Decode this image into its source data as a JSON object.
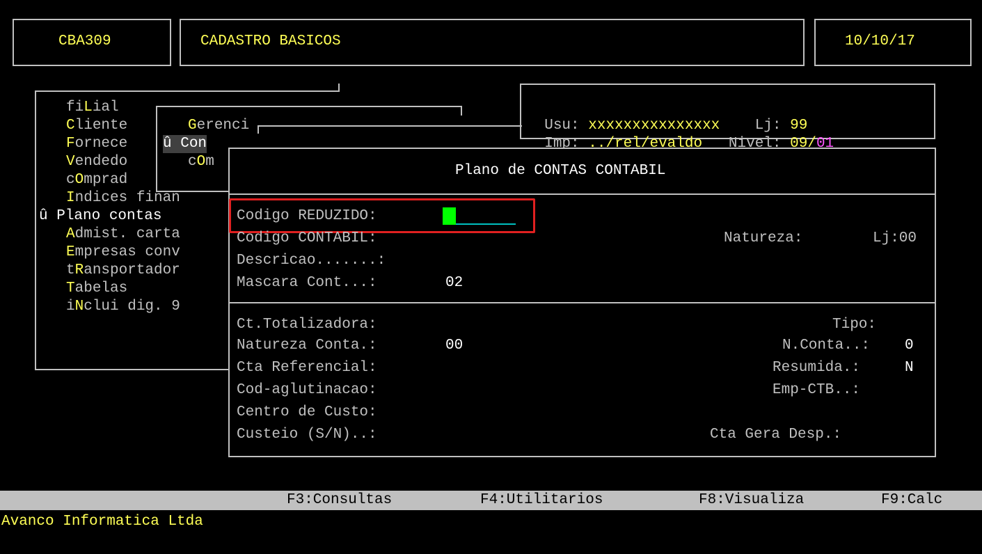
{
  "header": {
    "program_code": "CBA309",
    "title": "CADASTRO BASICOS",
    "date": "10/10/17"
  },
  "info": {
    "user_label": "Usu:",
    "user_value": "xxxxxxxxxxxxxxx",
    "store_label": "Lj:",
    "store_value": "99",
    "printer_label": "Imp:",
    "printer_value": "../rel/evaldo",
    "level_label": "Nivel:",
    "level_value": "09/",
    "level_sub": "01"
  },
  "main_menu": {
    "items": [
      {
        "hotkey": "",
        "pre": "fi",
        "key": "L",
        "rest": "ial"
      },
      {
        "hotkey": "C",
        "pre": "",
        "key": "",
        "rest": "liente"
      },
      {
        "hotkey": "F",
        "pre": "",
        "key": "",
        "rest": "ornece"
      },
      {
        "hotkey": "V",
        "pre": "",
        "key": "",
        "rest": "endedo"
      },
      {
        "hotkey": "",
        "pre": "c",
        "key": "O",
        "rest": "mprad"
      },
      {
        "hotkey": "I",
        "pre": "",
        "key": "",
        "rest": "ndices finan"
      },
      {
        "hotkey": "",
        "pre": "",
        "key": "",
        "rest": "Plano contas",
        "marker": "û "
      },
      {
        "hotkey": "A",
        "pre": "",
        "key": "",
        "rest": "dmist. carta"
      },
      {
        "hotkey": "E",
        "pre": "",
        "key": "",
        "rest": "mpresas conv"
      },
      {
        "hotkey": "",
        "pre": "t",
        "key": "R",
        "rest": "ansportador"
      },
      {
        "hotkey": "T",
        "pre": "",
        "key": "",
        "rest": "abelas"
      },
      {
        "hotkey": "",
        "pre": "i",
        "key": "N",
        "rest": "clui dig. 9"
      }
    ]
  },
  "sub_menu": {
    "item1_key": "G",
    "item1_rest": "erenci",
    "item2_marker": "û ",
    "item2_label": "Con",
    "item3_pre": "c",
    "item3_key": "O",
    "item3_rest": "m"
  },
  "dialog": {
    "title": "Plano de CONTAS CONTABIL",
    "codigo_reduzido": "Codigo REDUZIDO:",
    "codigo_contabil": "Codigo CONTABIL:",
    "natureza": "Natureza:",
    "lj": "Lj:00",
    "descricao": "Descricao.......:",
    "mascara": "Mascara Cont...:",
    "mascara_value": "02",
    "ct_totalizadora": "Ct.Totalizadora:",
    "tipo": "Tipo:",
    "natureza_conta": "Natureza Conta.:",
    "natureza_conta_value": "00",
    "n_conta": "N.Conta..:",
    "n_conta_value": "0",
    "cta_referencial": "Cta Referencial:",
    "resumida": "Resumida.:",
    "resumida_value": "N",
    "cod_aglutinacao": "Cod-aglutinacao:",
    "emp_ctb": "Emp-CTB..:",
    "centro_custo": "Centro de Custo:",
    "custeio": "Custeio (S/N)..:",
    "cta_gera_desp": "Cta Gera Desp.:"
  },
  "function_keys": [
    {
      "label": "F3:Consultas"
    },
    {
      "label": "F4:Utilitarios"
    },
    {
      "label": "F8:Visualiza"
    },
    {
      "label": "F9:Calc"
    }
  ],
  "footer": {
    "company": "Avanco Informatica Ltda"
  },
  "colors": {
    "background": "#000000",
    "text": "#c0c0c0",
    "hotkey": "#ffff55",
    "cursor": "#00ff00",
    "highlight_box": "#e02020",
    "status_bar": "#c0c0c0"
  }
}
